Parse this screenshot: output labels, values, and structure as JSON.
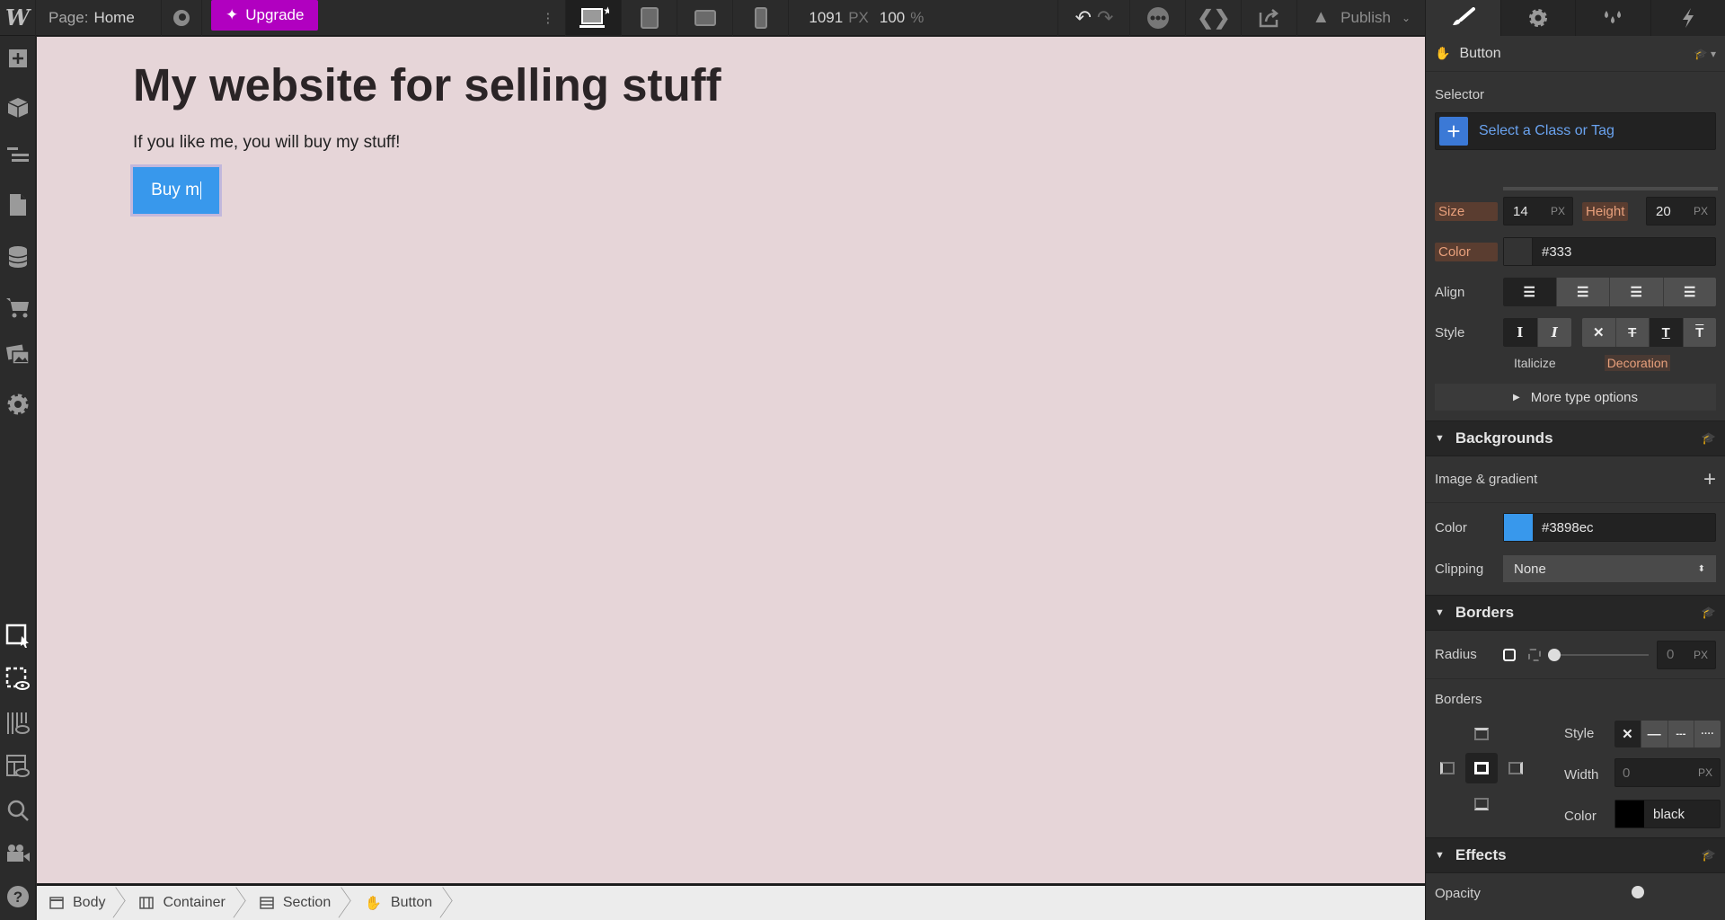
{
  "topbar": {
    "logo": "W",
    "page_prefix": "Page:",
    "page_name": "Home",
    "upgrade_label": "Upgrade",
    "canvas_width": "1091",
    "canvas_width_unit": "PX",
    "zoom": "100",
    "zoom_unit": "%",
    "publish_label": "Publish",
    "devices": [
      "desktop-icon",
      "tablet-icon",
      "mobile-landscape-icon",
      "mobile-portrait-icon"
    ],
    "active_device": "desktop"
  },
  "left_toolbar": {
    "items": [
      "add-icon",
      "components-icon",
      "navigator-icon",
      "pages-icon",
      "cms-icon",
      "ecommerce-icon",
      "assets-icon",
      "settings-icon"
    ],
    "bottom_items": [
      "select-element-icon",
      "preview-hidden-icon",
      "x-ray-icon",
      "layout-preview-icon",
      "search-icon",
      "video-tutorials-icon",
      "help-icon"
    ]
  },
  "canvas": {
    "heading": "My website for selling stuff",
    "paragraph": "If you like me, you will buy my stuff!",
    "button_text": "Buy m"
  },
  "breadcrumb": [
    {
      "label": "Body",
      "icon": "body-icon"
    },
    {
      "label": "Container",
      "icon": "container-icon"
    },
    {
      "label": "Section",
      "icon": "section-icon"
    },
    {
      "label": "Button",
      "icon": "hand-icon"
    }
  ],
  "panel": {
    "tabs": [
      "style-brush-icon",
      "settings-gear-icon",
      "interactions-drops-icon",
      "lightning-icon"
    ],
    "element_name": "Button",
    "selector_label": "Selector",
    "selector_placeholder": "Select a Class or Tag",
    "typography": {
      "size_label": "Size",
      "size_value": "14",
      "size_unit": "PX",
      "height_label": "Height",
      "height_value": "20",
      "height_unit": "PX",
      "color_label": "Color",
      "color_value": "#333",
      "align_label": "Align",
      "style_label": "Style",
      "italicize_label": "Italicize",
      "decoration_label": "Decoration",
      "more_label": "More type options"
    },
    "backgrounds": {
      "title": "Backgrounds",
      "image_gradient_label": "Image & gradient",
      "color_label": "Color",
      "color_value": "#3898ec",
      "clipping_label": "Clipping",
      "clipping_value": "None"
    },
    "borders": {
      "title": "Borders",
      "radius_label": "Radius",
      "radius_value": "0",
      "radius_unit": "PX",
      "borders_label": "Borders",
      "style_label": "Style",
      "width_label": "Width",
      "width_value": "0",
      "width_unit": "PX",
      "color_label": "Color",
      "color_value": "black"
    },
    "effects": {
      "title": "Effects",
      "opacity_label": "Opacity",
      "opacity_value": "100",
      "opacity_unit": "%"
    }
  },
  "colors": {
    "upgrade": "#b100c0",
    "button_bg": "#3898ec",
    "canvas_bg": "#e6d5d8",
    "label_highlight": "#e8a07c"
  }
}
